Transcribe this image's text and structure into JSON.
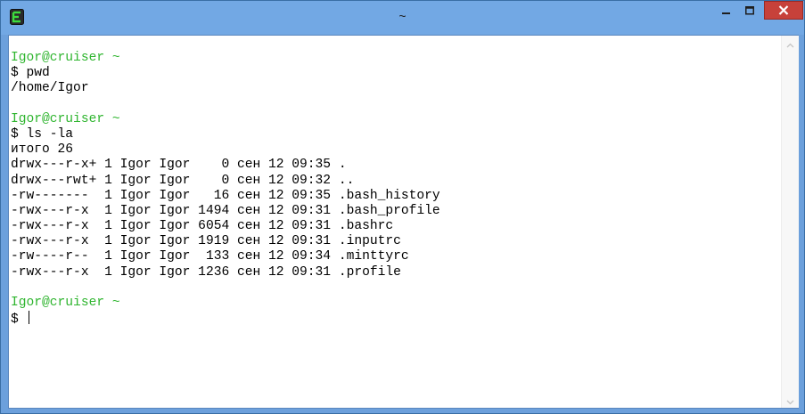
{
  "window": {
    "title": "~",
    "app_icon": "mintty-terminal-icon",
    "colors": {
      "title_bar": "#72a8e4",
      "close_button": "#c7413a",
      "prompt_green": "#2fb52f",
      "text": "#000000",
      "background": "#ffffff"
    }
  },
  "terminal": {
    "lines": [
      {
        "text": "Igor@cruiser ~",
        "type": "prompt"
      },
      {
        "text": "$ pwd",
        "type": "command"
      },
      {
        "text": "/home/Igor",
        "type": "output"
      },
      {
        "text": "",
        "type": "blank"
      },
      {
        "text": "Igor@cruiser ~",
        "type": "prompt"
      },
      {
        "text": "$ ls -la",
        "type": "command"
      },
      {
        "text": "итого 26",
        "type": "output"
      },
      {
        "text": "drwx---r-x+ 1 Igor Igor    0 сен 12 09:35 .",
        "type": "output"
      },
      {
        "text": "drwx---rwt+ 1 Igor Igor    0 сен 12 09:32 ..",
        "type": "output"
      },
      {
        "text": "-rw-------  1 Igor Igor   16 сен 12 09:35 .bash_history",
        "type": "output"
      },
      {
        "text": "-rwx---r-x  1 Igor Igor 1494 сен 12 09:31 .bash_profile",
        "type": "output"
      },
      {
        "text": "-rwx---r-x  1 Igor Igor 6054 сен 12 09:31 .bashrc",
        "type": "output"
      },
      {
        "text": "-rwx---r-x  1 Igor Igor 1919 сен 12 09:31 .inputrc",
        "type": "output"
      },
      {
        "text": "-rw----r--  1 Igor Igor  133 сен 12 09:34 .minttyrc",
        "type": "output"
      },
      {
        "text": "-rwx---r-x  1 Igor Igor 1236 сен 12 09:31 .profile",
        "type": "output"
      },
      {
        "text": "",
        "type": "blank"
      },
      {
        "text": "Igor@cruiser ~",
        "type": "prompt"
      },
      {
        "text": "$ ",
        "type": "input"
      }
    ]
  },
  "icons": {
    "minimize": "minimize-icon",
    "maximize": "maximize-icon",
    "close": "close-icon",
    "scroll_up": "chevron-up-icon",
    "scroll_down": "chevron-down-icon"
  }
}
